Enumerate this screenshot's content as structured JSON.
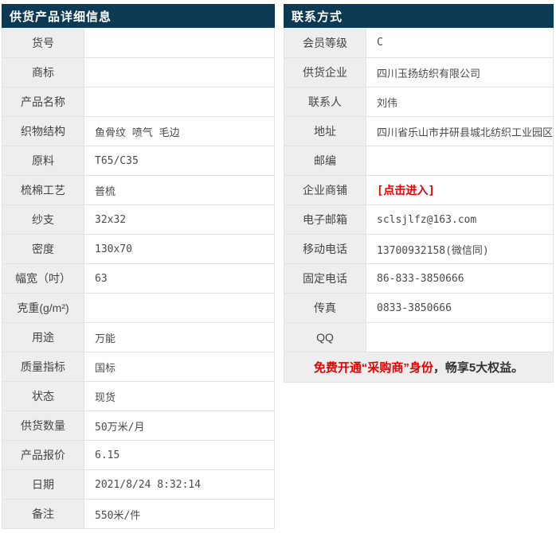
{
  "colors": {
    "header_bg": "#0c3a52",
    "label_bg": "#eeeeee",
    "border": "#e2e2e2",
    "link_red": "#e60000"
  },
  "left_table": {
    "title": "供货产品详细信息",
    "rows": [
      {
        "label": "货号",
        "value": ""
      },
      {
        "label": "商标",
        "value": ""
      },
      {
        "label": "产品名称",
        "value": ""
      },
      {
        "label": "织物结构",
        "value": "鱼骨纹 喷气 毛边"
      },
      {
        "label": "原料",
        "value": "T65/C35"
      },
      {
        "label": "梳棉工艺",
        "value": "普梳"
      },
      {
        "label": "纱支",
        "value": "32x32"
      },
      {
        "label": "密度",
        "value": "130x70"
      },
      {
        "label": "幅宽（吋）",
        "value": "63"
      },
      {
        "label": "克重(g/m²)",
        "value": ""
      },
      {
        "label": "用途",
        "value": "万能"
      },
      {
        "label": "质量指标",
        "value": "国标"
      },
      {
        "label": "状态",
        "value": "现货"
      },
      {
        "label": "供货数量",
        "value": "50万米/月"
      },
      {
        "label": "产品报价",
        "value": "6.15"
      },
      {
        "label": "日期",
        "value": "2021/8/24 8:32:14"
      },
      {
        "label": "备注",
        "value": "550米/件"
      }
    ]
  },
  "right_table": {
    "title": "联系方式",
    "rows": [
      {
        "label": "会员等级",
        "value": "C"
      },
      {
        "label": "供货企业",
        "value": "四川玉扬纺织有限公司"
      },
      {
        "label": "联系人",
        "value": "刘伟"
      },
      {
        "label": "地址",
        "value": "四川省乐山市井研县城北纺织工业园区"
      },
      {
        "label": "邮编",
        "value": ""
      },
      {
        "label": "企业商铺",
        "value": "[点击进入]"
      },
      {
        "label": "电子邮箱",
        "value": "sclsjlfz@163.com"
      },
      {
        "label": "移动电话",
        "value": "13700932158(微信同)"
      },
      {
        "label": "固定电话",
        "value": "86-833-3850666"
      },
      {
        "label": "传真",
        "value": "0833-3850666"
      },
      {
        "label": "QQ",
        "value": ""
      }
    ],
    "promo": {
      "highlight": "免费开通“采购商”身份",
      "rest": "，畅享5大权益。"
    }
  }
}
